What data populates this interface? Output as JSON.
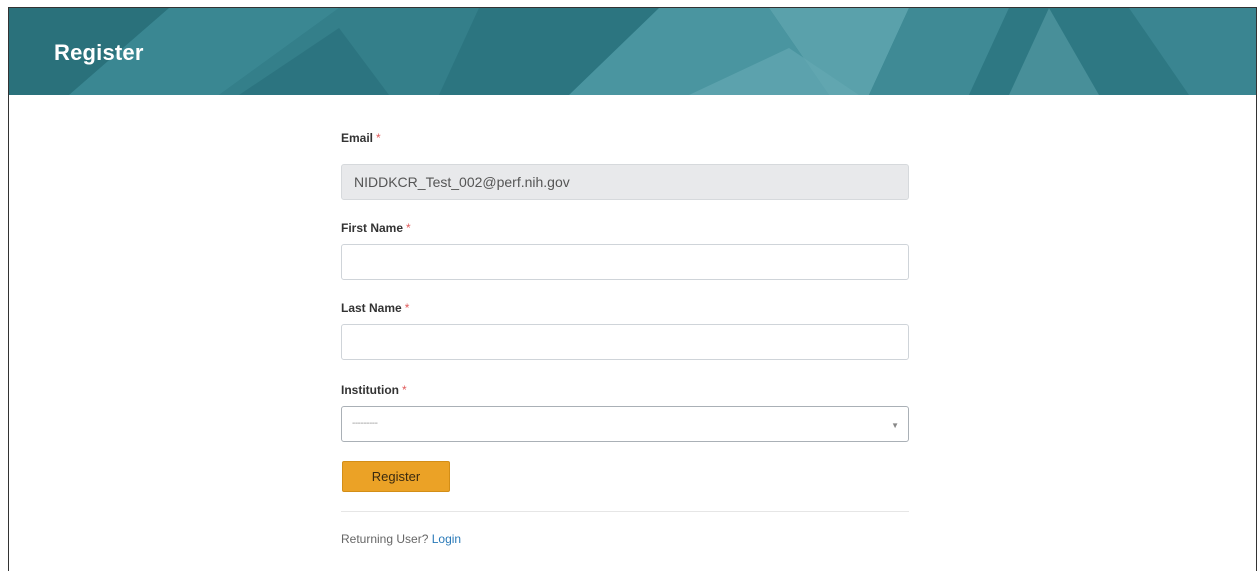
{
  "header": {
    "title": "Register",
    "color": "#2f7b86"
  },
  "form": {
    "email": {
      "label": "Email",
      "required_mark": "*",
      "value": "NIDDKCR_Test_002@perf.nih.gov"
    },
    "first_name": {
      "label": "First Name",
      "required_mark": "*",
      "value": ""
    },
    "last_name": {
      "label": "Last Name",
      "required_mark": "*",
      "value": ""
    },
    "institution": {
      "label": "Institution",
      "required_mark": "*",
      "selected": "---------",
      "caret_icon": "caret-down-icon"
    },
    "submit_label": "Register",
    "accent_color": "#eba226"
  },
  "footer": {
    "prompt": "Returning User?",
    "login_link": "Login",
    "link_color": "#2a7ab8"
  }
}
